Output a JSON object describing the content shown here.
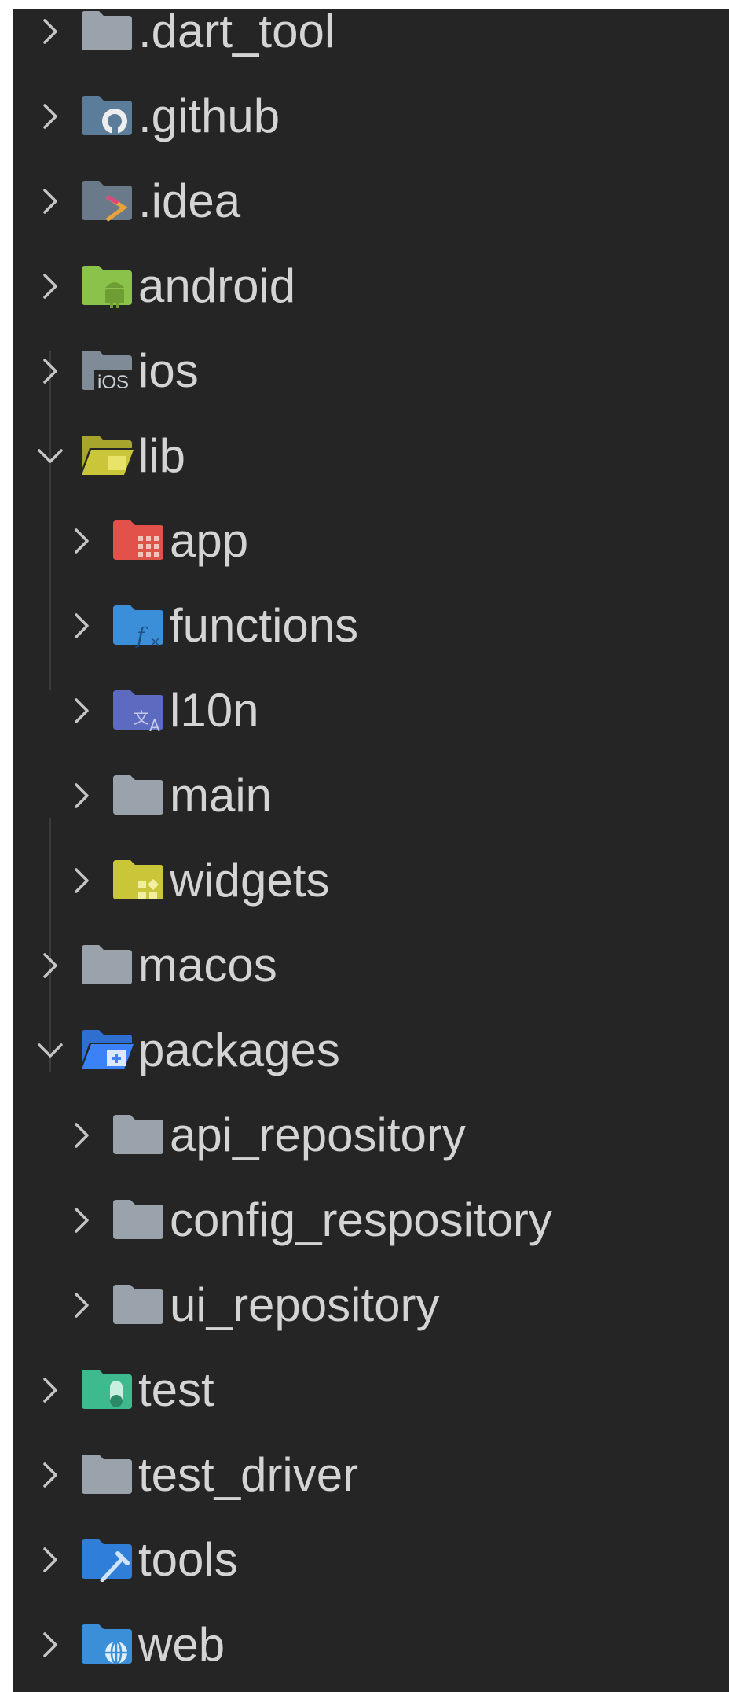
{
  "explorer": {
    "items": [
      {
        "label": ".dart_tool",
        "expanded": false,
        "icon": "folder-icon"
      },
      {
        "label": ".github",
        "expanded": false,
        "icon": "github-folder-icon"
      },
      {
        "label": ".idea",
        "expanded": false,
        "icon": "idea-folder-icon"
      },
      {
        "label": "android",
        "expanded": false,
        "icon": "android-folder-icon"
      },
      {
        "label": "ios",
        "expanded": false,
        "icon": "ios-folder-icon"
      },
      {
        "label": "lib",
        "expanded": true,
        "icon": "lib-folder-open-icon"
      },
      {
        "label": "app",
        "expanded": false,
        "icon": "app-folder-icon"
      },
      {
        "label": "functions",
        "expanded": false,
        "icon": "functions-folder-icon"
      },
      {
        "label": "l10n",
        "expanded": false,
        "icon": "l10n-folder-icon"
      },
      {
        "label": "main",
        "expanded": false,
        "icon": "folder-icon"
      },
      {
        "label": "widgets",
        "expanded": false,
        "icon": "widgets-folder-icon"
      },
      {
        "label": "macos",
        "expanded": false,
        "icon": "folder-icon"
      },
      {
        "label": "packages",
        "expanded": true,
        "icon": "packages-folder-open-icon"
      },
      {
        "label": "api_repository",
        "expanded": false,
        "icon": "folder-icon"
      },
      {
        "label": "config_respository",
        "expanded": false,
        "icon": "folder-icon"
      },
      {
        "label": "ui_repository",
        "expanded": false,
        "icon": "folder-icon"
      },
      {
        "label": "test",
        "expanded": false,
        "icon": "test-folder-icon"
      },
      {
        "label": "test_driver",
        "expanded": false,
        "icon": "folder-icon"
      },
      {
        "label": "tools",
        "expanded": false,
        "icon": "tools-folder-icon"
      },
      {
        "label": "web",
        "expanded": false,
        "icon": "web-folder-icon"
      }
    ]
  },
  "colors": {
    "background": "#252526",
    "text": "#d4d4d4",
    "chevron": "#c5c5c5",
    "folder_gray": "#9aa3ab",
    "github_blue": "#5c7d99",
    "android_green": "#8bc34a",
    "lib_yellow": "#c9c63a",
    "app_red": "#e2514a",
    "functions_blue": "#3b8fd9",
    "l10n_indigo": "#5c6bc0",
    "packages_blue": "#3b82f6",
    "test_teal": "#3dbb8f",
    "tools_blue": "#2f7fd8",
    "web_blue": "#3b8fd9"
  }
}
